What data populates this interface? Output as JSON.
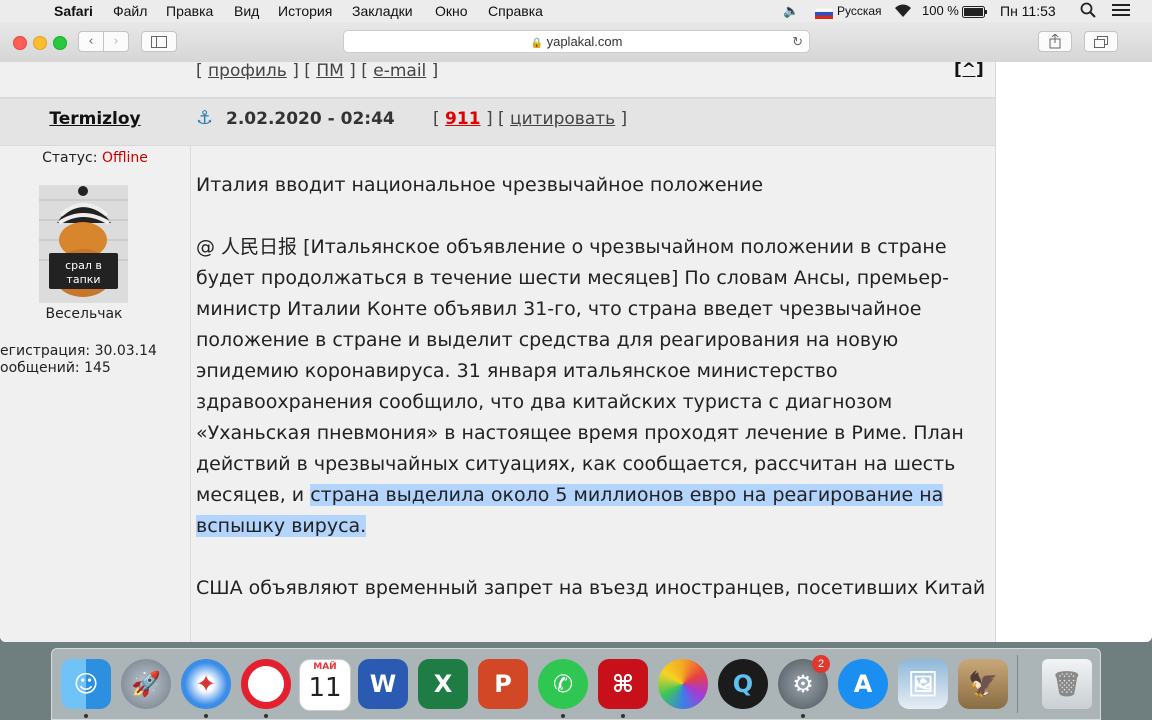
{
  "menubar": {
    "apple": "",
    "app": "Safari",
    "items": [
      "Файл",
      "Правка",
      "Вид",
      "История",
      "Закладки",
      "Окно",
      "Справка"
    ],
    "input_source": "Русская",
    "battery": "100 %",
    "clock": "Пн 11:53"
  },
  "browser": {
    "url": "yaplakal.com",
    "new_tab": "+"
  },
  "topnav": {
    "profile": "профиль",
    "pm": "ПМ",
    "email": "e-mail",
    "up": "[^]"
  },
  "post": {
    "author": "Termizloy",
    "status_label": "Статус:",
    "status_value": "Offline",
    "avatar_text_1": "срал в",
    "avatar_text_2": "тапки",
    "rank": "Весельчак",
    "reg": "егистрация: 30.03.14",
    "posts": "ообщений: 145",
    "anchor_icon": "⚓",
    "date": "2.02.2020 - 02:44",
    "rating": "911",
    "quote": "цитировать",
    "title_line": "Италия вводит национальное чрезвычайное положение",
    "para_before_highlight": "@ 人民日报 [Итальянское объявление о чрезвычайном положении в стране будет продолжаться в течение шести месяцев] По словам Ансы, премьер-министр Италии Конте объявил 31-го, что страна введет чрезвычайное положение в стране и выделит средства для реагирования на новую эпидемию коронавируса. 31 января итальянское министерство здравоохранения сообщило, что два китайских туриста с диагнозом «Уханьская пневмония» в настоящее время проходят лечение в Риме. План действий в чрезвычайных ситуациях, как сообщается, рассчитан на шесть месяцев, и ",
    "highlighted": "страна выделила около 5 миллионов евро на реагирование на вспышку вируса.",
    "para2": "США объявляют временный запрет на въезд иностранцев, посетивших Китай"
  },
  "dock": {
    "calendar_month": "МАЙ",
    "calendar_day": "11",
    "badge": "2"
  },
  "colors": {
    "offline": "#cc0000",
    "rating": "#e00000",
    "highlight": "#b3d4fd"
  }
}
